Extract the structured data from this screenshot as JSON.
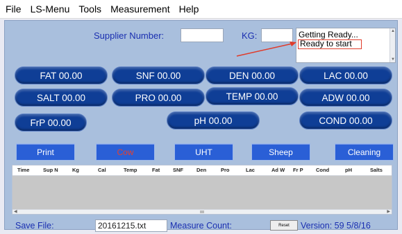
{
  "menu": [
    "File",
    "LS-Menu",
    "Tools",
    "Measurement",
    "Help"
  ],
  "form": {
    "supplier_label": "Supplier Number:",
    "supplier_value": "",
    "kg_label": "KG:",
    "kg_value": ""
  },
  "status": {
    "line1": "Getting Ready...",
    "line2": "Ready to start"
  },
  "readings": {
    "fat": "FAT 00.00",
    "snf": "SNF 00.00",
    "den": "DEN 00.00",
    "lac": "LAC 00.00",
    "salt": "SALT 00.00",
    "pro": "PRO 00.00",
    "temp": "TEMP 00.00",
    "adw": "ADW 00.00",
    "frp": "FrP 00.00",
    "ph": "pH 00.00",
    "cond": "COND 00.00"
  },
  "buttons": {
    "print": "Print",
    "cow": "Cow",
    "uht": "UHT",
    "sheep": "Sheep",
    "cleaning": "Cleaning"
  },
  "table": {
    "columns": [
      "Time",
      "Sup N",
      "Kg",
      "Cal",
      "Temp",
      "Fat",
      "SNF",
      "Den",
      "Pro",
      "Lac",
      "Ad W",
      "Fr P",
      "Cond",
      "pH",
      "Salts"
    ]
  },
  "footer": {
    "save_file_label": "Save File:",
    "save_file_value": "20161215.txt",
    "measure_count_label": "Measure Count:",
    "reset_label": "Reset",
    "version": "Version: 59  5/8/16"
  },
  "colors": {
    "panel": "#a9bfdd",
    "pill": "#0f3e96",
    "button": "#2a5fd6",
    "label_text": "#1a2fb0",
    "highlight": "#e03b2a"
  }
}
